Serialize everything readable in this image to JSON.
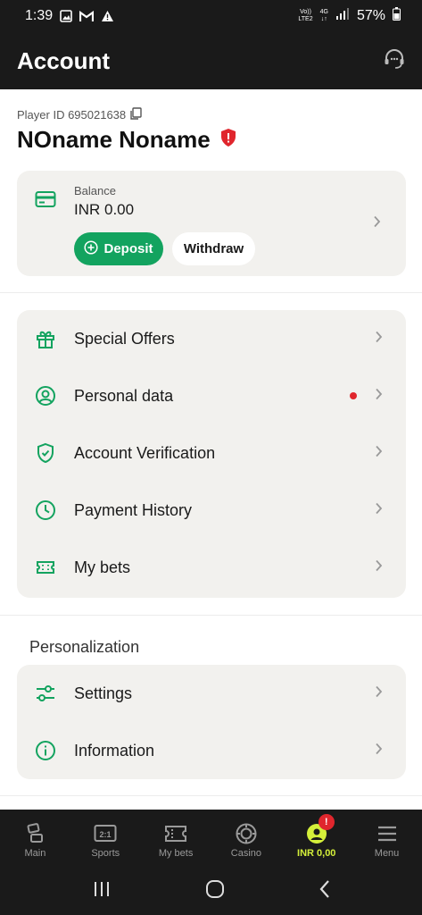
{
  "status_bar": {
    "time": "1:39",
    "network_top": "Vo))",
    "network_bottom": "LTE2",
    "net_type": "4G",
    "battery": "57%"
  },
  "header": {
    "title": "Account"
  },
  "profile": {
    "player_id": "Player ID 695021638",
    "name": "NOname Noname"
  },
  "balance": {
    "label": "Balance",
    "value": "INR 0.00",
    "deposit_label": "Deposit",
    "withdraw_label": "Withdraw"
  },
  "menu": {
    "items": [
      {
        "label": "Special Offers",
        "icon": "gift-icon"
      },
      {
        "label": "Personal data",
        "icon": "user-circle-icon",
        "notification_dot": true
      },
      {
        "label": "Account Verification",
        "icon": "shield-check-icon"
      },
      {
        "label": "Payment History",
        "icon": "clock-icon"
      },
      {
        "label": "My bets",
        "icon": "ticket-icon"
      }
    ]
  },
  "personalization": {
    "title": "Personalization",
    "items": [
      {
        "label": "Settings",
        "icon": "sliders-icon"
      },
      {
        "label": "Information",
        "icon": "info-icon"
      }
    ]
  },
  "bottom_nav": {
    "items": [
      {
        "label": "Main",
        "icon": "main-icon"
      },
      {
        "label": "Sports",
        "icon": "sports-icon",
        "icon_text": "2:1"
      },
      {
        "label": "My bets",
        "icon": "ticket-icon"
      },
      {
        "label": "Casino",
        "icon": "casino-chip-icon"
      },
      {
        "label": "INR 0,00",
        "icon": "user-icon",
        "active": true,
        "badge": "!"
      },
      {
        "label": "Menu",
        "icon": "hamburger-icon"
      }
    ]
  },
  "colors": {
    "accent_green": "#13a35f",
    "active_nav": "#d4ef3a",
    "alert_red": "#e0262d",
    "dark_bg": "#1a1a1a",
    "card_bg": "#f2f1ee"
  }
}
